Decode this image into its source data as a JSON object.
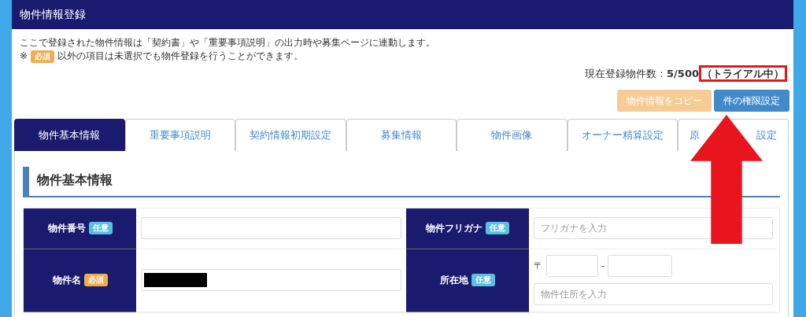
{
  "header": {
    "title": "物件情報登録"
  },
  "intro": [
    "ここで登録された物件情報は「契約書」や「重要事項説明」の出力時や募集ページに連動します。"
  ],
  "note": {
    "mark": "※",
    "badge": {
      "text": "必須",
      "kind": "required"
    },
    "text": "以外の項目は未選択でも物件登録を行うことができます。"
  },
  "count": {
    "label": "現在登録物件数：",
    "value": "5/500",
    "status": "（トライアル中）",
    "highlighted": true
  },
  "buttons": [
    {
      "label": "物件情報をコピー",
      "kind": "warning",
      "disabled": true
    },
    {
      "label": "件の権限設定",
      "kind": "primary",
      "disabled": false
    }
  ],
  "tabs": [
    {
      "label": "物件基本情報",
      "selected": true
    },
    {
      "label": "重要事項説明",
      "selected": false
    },
    {
      "label": "契約情報初期設定",
      "selected": false
    },
    {
      "label": "募集情報",
      "selected": false
    },
    {
      "label": "物件画像",
      "selected": false
    },
    {
      "label": "オーナー精算設定",
      "selected": false
    },
    {
      "label": "原",
      "label_right": "設定",
      "selected": false
    }
  ],
  "section": {
    "title": "物件基本情報"
  },
  "rows": [
    [
      {
        "label": "物件番号",
        "badge": {
          "text": "任意",
          "kind": "optional"
        },
        "field": {
          "kind": "text"
        }
      },
      {
        "label": "物件フリガナ",
        "badge": {
          "text": "任意",
          "kind": "optional"
        },
        "field": {
          "kind": "text",
          "placeholder": "フリガナを入力"
        }
      }
    ],
    [
      {
        "label": "物件名",
        "badge": {
          "text": "必須",
          "kind": "required"
        },
        "field": {
          "kind": "redacted"
        }
      },
      {
        "label": "所在地",
        "badge": {
          "text": "任意",
          "kind": "optional"
        },
        "field": {
          "kind": "address",
          "postal_mark": "〒",
          "separator": "-",
          "placeholder": "物件住所を入力"
        }
      }
    ]
  ],
  "annotation": {
    "kind": "arrow"
  }
}
